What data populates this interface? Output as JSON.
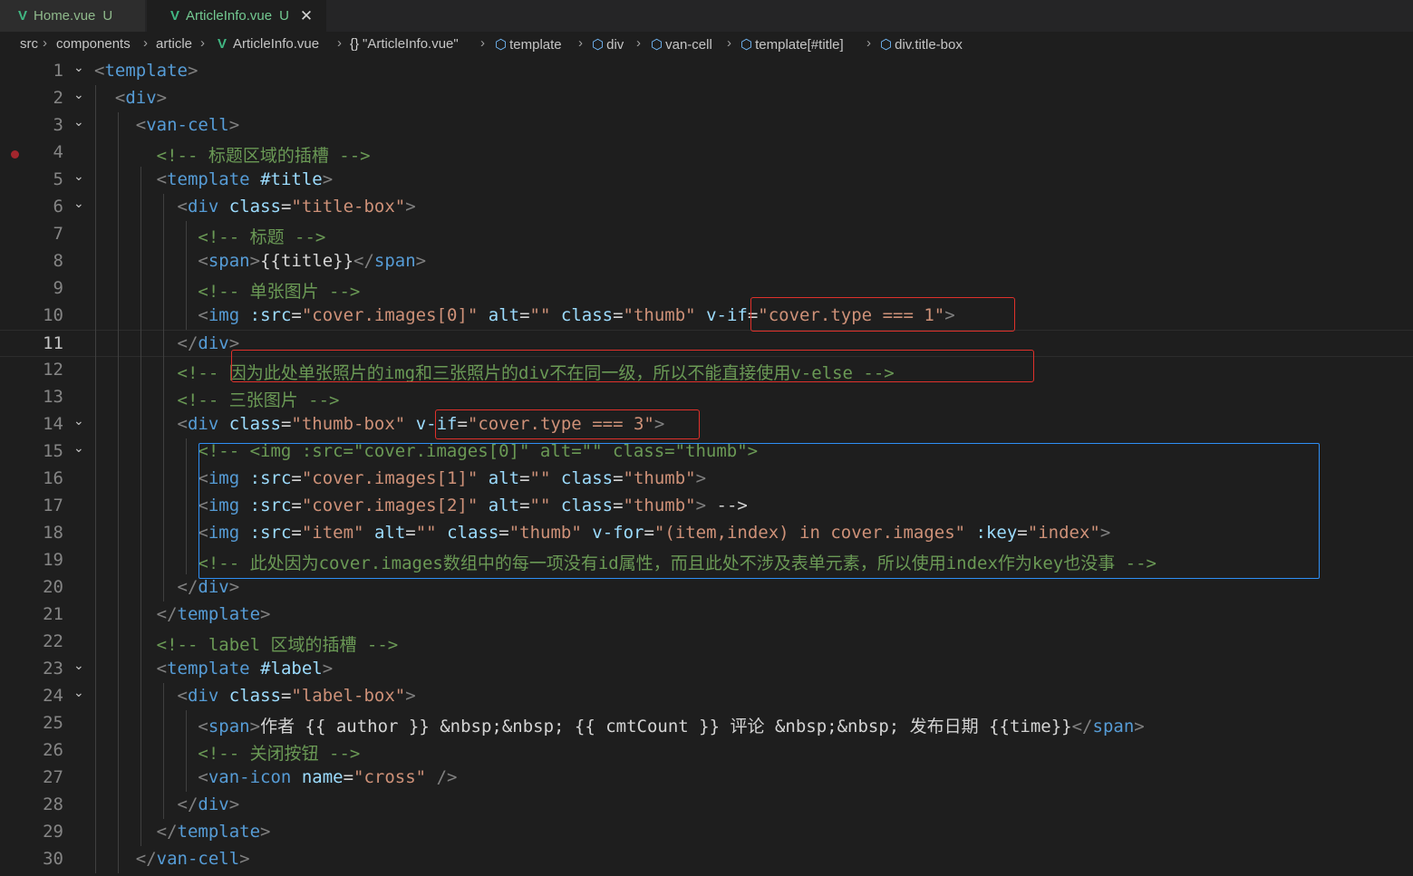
{
  "tabs": [
    {
      "label": "Home.vue",
      "status": "U",
      "active": false
    },
    {
      "label": "ArticleInfo.vue",
      "status": "U",
      "active": true,
      "close": "✕"
    }
  ],
  "breadcrumb": [
    "src",
    "components",
    "article",
    "ArticleInfo.vue",
    "\"ArticleInfo.vue\"",
    "template",
    "div",
    "van-cell",
    "template[#title]",
    "div.title-box"
  ],
  "editor": {
    "current_line": "11",
    "lines": [
      {
        "n": "1",
        "code": "<template>"
      },
      {
        "n": "2",
        "code": "  <div>"
      },
      {
        "n": "3",
        "code": "    <van-cell>"
      },
      {
        "n": "4",
        "code": "      <!-- 标题区域的插槽 -->"
      },
      {
        "n": "5",
        "code": "      <template #title>"
      },
      {
        "n": "6",
        "code": "        <div class=\"title-box\">"
      },
      {
        "n": "7",
        "code": "          <!-- 标题 -->"
      },
      {
        "n": "8",
        "code": "          <span>{{title}}</span>"
      },
      {
        "n": "9",
        "code": "          <!-- 单张图片 -->"
      },
      {
        "n": "10",
        "code": "          <img :src=\"cover.images[0]\" alt=\"\" class=\"thumb\" v-if=\"cover.type === 1\">"
      },
      {
        "n": "11",
        "code": "        </div>"
      },
      {
        "n": "12",
        "code": "        <!-- 因为此处单张照片的img和三张照片的div不在同一级，所以不能直接使用v-else -->"
      },
      {
        "n": "13",
        "code": "        <!-- 三张图片 -->"
      },
      {
        "n": "14",
        "code": "        <div class=\"thumb-box\" v-if=\"cover.type === 3\">"
      },
      {
        "n": "15",
        "code": "          <!-- <img :src=\"cover.images[0]\" alt=\"\" class=\"thumb\">"
      },
      {
        "n": "16",
        "code": "          <img :src=\"cover.images[1]\" alt=\"\" class=\"thumb\">"
      },
      {
        "n": "17",
        "code": "          <img :src=\"cover.images[2]\" alt=\"\" class=\"thumb\"> -->"
      },
      {
        "n": "18",
        "code": "          <img :src=\"item\" alt=\"\" class=\"thumb\" v-for=\"(item,index) in cover.images\" :key=\"index\">"
      },
      {
        "n": "19",
        "code": "          <!-- 此处因为cover.images数组中的每一项没有id属性，而且此处不涉及表单元素，所以使用index作为key也没事 -->"
      },
      {
        "n": "20",
        "code": "        </div>"
      },
      {
        "n": "21",
        "code": "      </template>"
      },
      {
        "n": "22",
        "code": "      <!-- label 区域的插槽 -->"
      },
      {
        "n": "23",
        "code": "      <template #label>"
      },
      {
        "n": "24",
        "code": "        <div class=\"label-box\">"
      },
      {
        "n": "25",
        "code": "          <span>作者 {{ author }} &nbsp;&nbsp; {{ cmtCount }} 评论 &nbsp;&nbsp; 发布日期 {{time}}</span>"
      },
      {
        "n": "26",
        "code": "          <!-- 关闭按钮 -->"
      },
      {
        "n": "27",
        "code": "          <van-icon name=\"cross\" />"
      },
      {
        "n": "28",
        "code": "        </div>"
      },
      {
        "n": "29",
        "code": "      </template>"
      },
      {
        "n": "30",
        "code": "    </van-cell>"
      }
    ]
  }
}
